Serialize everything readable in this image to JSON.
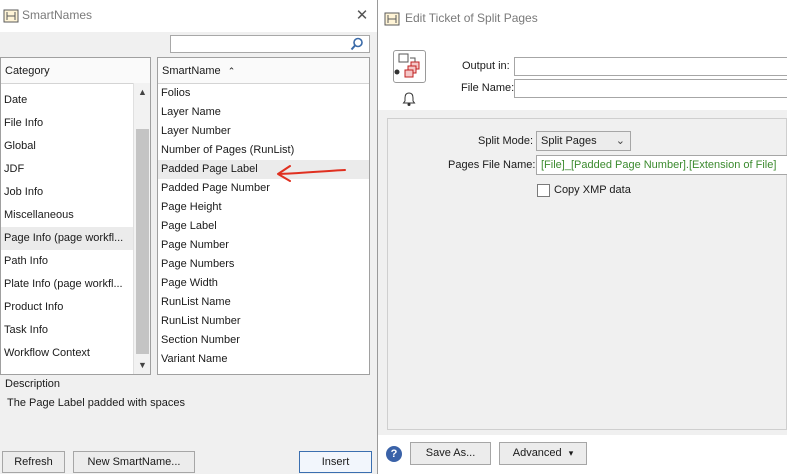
{
  "smartnames": {
    "title": "SmartNames",
    "search_value": "",
    "category_header": "Category",
    "smartname_header": "SmartName",
    "sort_indicator": "^",
    "categories": [
      "Date",
      "File Info",
      "Global",
      "JDF",
      "Job Info",
      "Miscellaneous",
      "Page Info (page workfl...",
      "Path Info",
      "Plate Info (page workfl...",
      "Product Info",
      "Task Info",
      "Workflow Context"
    ],
    "selected_category": "Page Info (page workfl...",
    "smartnames_list": [
      "Folios",
      "Layer Name",
      "Layer Number",
      "Number of Pages (RunList)",
      "Padded Page Label",
      "Padded Page Number",
      "Page Height",
      "Page Label",
      "Page Number",
      "Page Numbers",
      "Page Width",
      "RunList Name",
      "RunList Number",
      "Section Number",
      "Variant Name"
    ],
    "selected_smartname": "Padded Page Label",
    "description_label": "Description",
    "description_text": "The Page Label padded with spaces",
    "buttons": {
      "refresh": "Refresh",
      "new_smartname": "New SmartName...",
      "insert": "Insert"
    }
  },
  "edit_ticket": {
    "title": "Edit Ticket of Split Pages",
    "output_in_label": "Output in:",
    "output_in_value": "",
    "file_name_label": "File Name:",
    "file_name_value": "",
    "split_mode_label": "Split Mode:",
    "split_mode_value": "Split Pages",
    "pages_file_name_label": "Pages File Name:",
    "pages_file_name_value": "[File]_[Padded Page Number].[Extension of File]",
    "copy_xmp_label": "Copy XMP data",
    "copy_xmp_checked": false,
    "buttons": {
      "help": "?",
      "save_as": "Save As...",
      "advanced": "Advanced",
      "advanced_arrow": "▾"
    }
  },
  "colors": {
    "annotation_arrow": "#e03020",
    "smartname_text": "#3b8a2e",
    "accent_button_border": "#3b6fb0"
  }
}
